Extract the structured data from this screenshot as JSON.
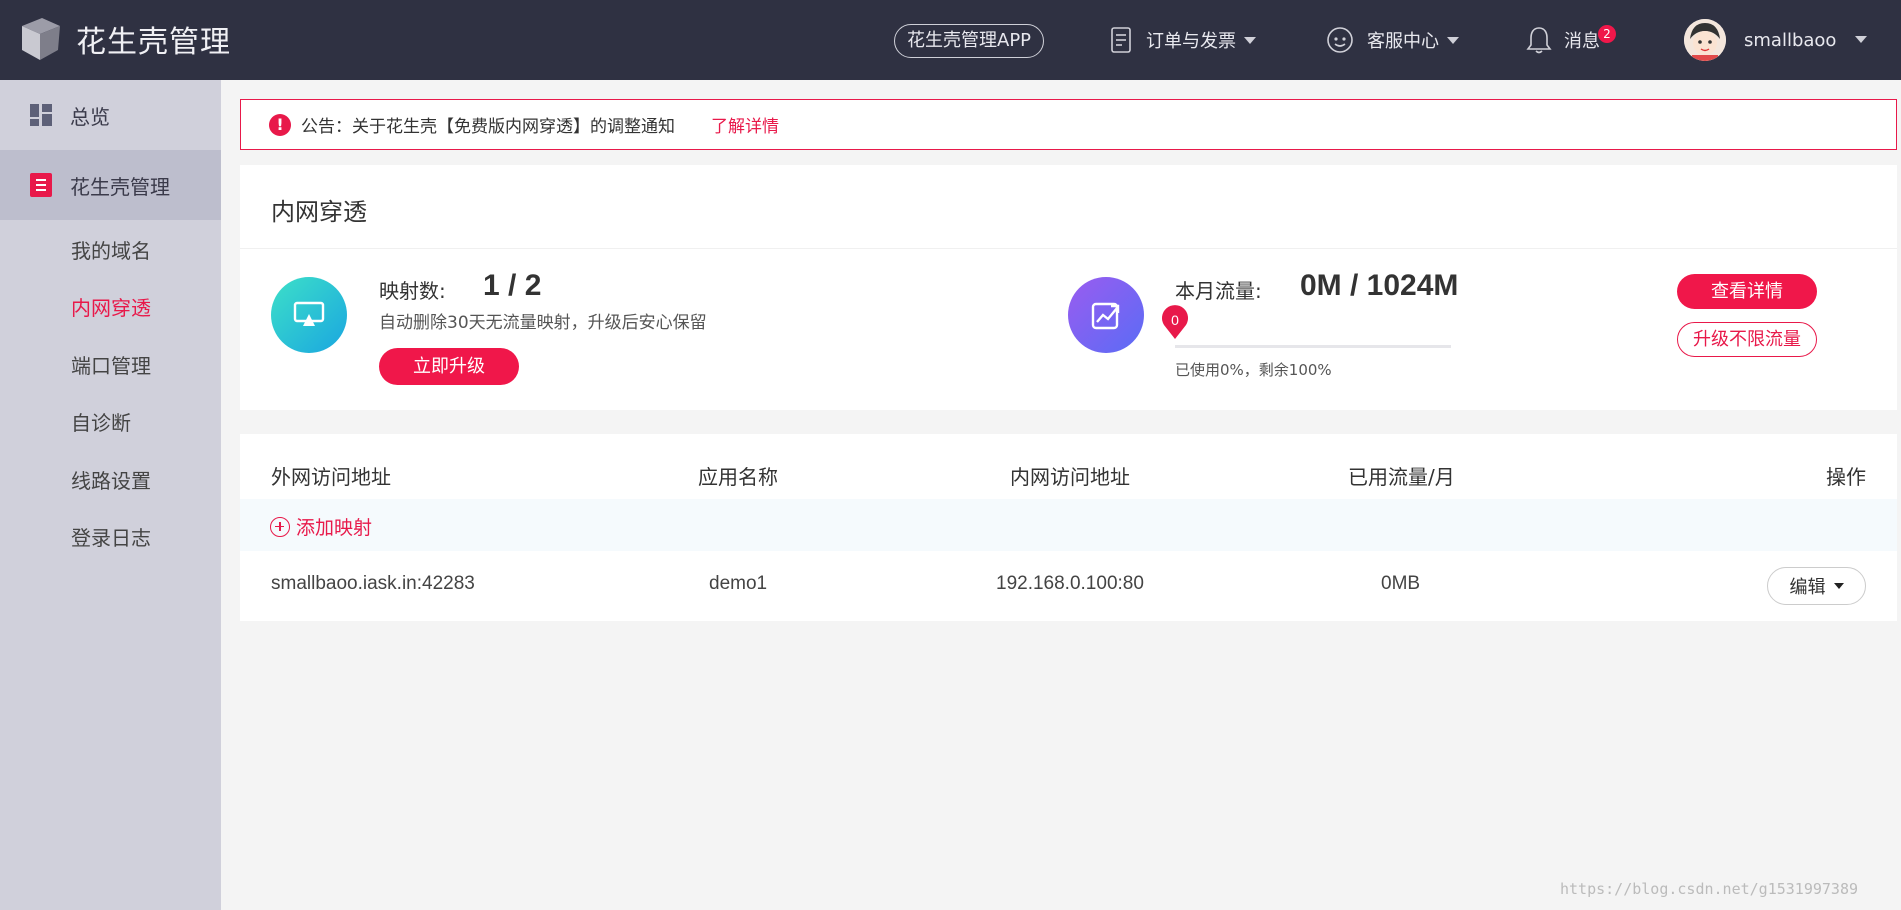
{
  "brand": {
    "name": "花生壳管理"
  },
  "header": {
    "app_button": "花生壳管理APP",
    "orders": "订单与发票",
    "support": "客服中心",
    "messages": "消息",
    "messages_badge": "2",
    "username": "smallbaoo"
  },
  "sidebar": {
    "overview": "总览",
    "group": "花生壳管理",
    "items": [
      {
        "label": "我的域名"
      },
      {
        "label": "内网穿透"
      },
      {
        "label": "端口管理"
      },
      {
        "label": "自诊断"
      },
      {
        "label": "线路设置"
      },
      {
        "label": "登录日志"
      }
    ],
    "active_index": 1
  },
  "notice": {
    "text": "公告：关于花生壳【免费版内网穿透】的调整通知",
    "link": "了解详情"
  },
  "tunnel": {
    "title": "内网穿透",
    "mapping_label": "映射数:",
    "mapping_value": "1 / 2",
    "mapping_hint": "自动删除30天无流量映射，升级后安心保留",
    "upgrade_button": "立即升级",
    "traffic_label": "本月流量:",
    "traffic_value": "0M / 1024M",
    "traffic_used_pct": 0,
    "traffic_pin": "0",
    "traffic_note": "已使用0%，剩余100%",
    "details_button": "查看详情",
    "unlimited_button": "升级不限流量"
  },
  "table": {
    "headers": [
      "外网访问地址",
      "应用名称",
      "内网访问地址",
      "已用流量/月",
      "操作"
    ],
    "add_label": "添加映射",
    "rows": [
      {
        "external": "smallbaoo.iask.in:42283",
        "app": "demo1",
        "internal": "192.168.0.100:80",
        "traffic": "0MB",
        "action": "编辑"
      }
    ]
  },
  "watermark": "https://blog.csdn.net/g1531997389",
  "colors": {
    "accent": "#e8194a",
    "topbar": "#2f3142",
    "sidebar": "#d0d0db"
  }
}
